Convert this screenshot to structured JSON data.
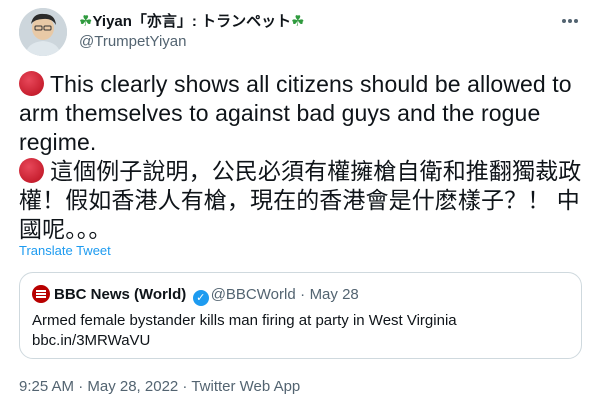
{
  "author": {
    "display_name": "Yiyan「亦言」: トランペット",
    "leading_emoji": "☘",
    "trailing_emoji": "☘",
    "handle": "@TrumpetYiyan"
  },
  "tweet": {
    "paragraph_1": "This clearly shows all citizens should be allowed to arm themselves to against bad guys and the rogue regime.",
    "paragraph_2": "這個例子說明，公民必須有權擁槍自衛和推翻獨裁政權！假如香港人有槍，現在的香港會是什麽樣子？！ 中國呢。。。",
    "bullet_icon": "red-circle-icon",
    "translate_label": "Translate Tweet"
  },
  "quoted_tweet": {
    "author_name": "BBC News (World)",
    "handle": "@BBCWorld",
    "separator": "·",
    "date": "May 28",
    "text": "Armed female bystander kills man firing at party in West Virginia",
    "link": "bbc.in/3MRWaVU"
  },
  "footer": {
    "timestamp": "9:25 AM · May 28, 2022 · Twitter Web App"
  },
  "colors": {
    "accent": "#1d9bf0",
    "muted": "#536471",
    "bullet_red": "#c71f2f",
    "bbc_red": "#b80000"
  }
}
